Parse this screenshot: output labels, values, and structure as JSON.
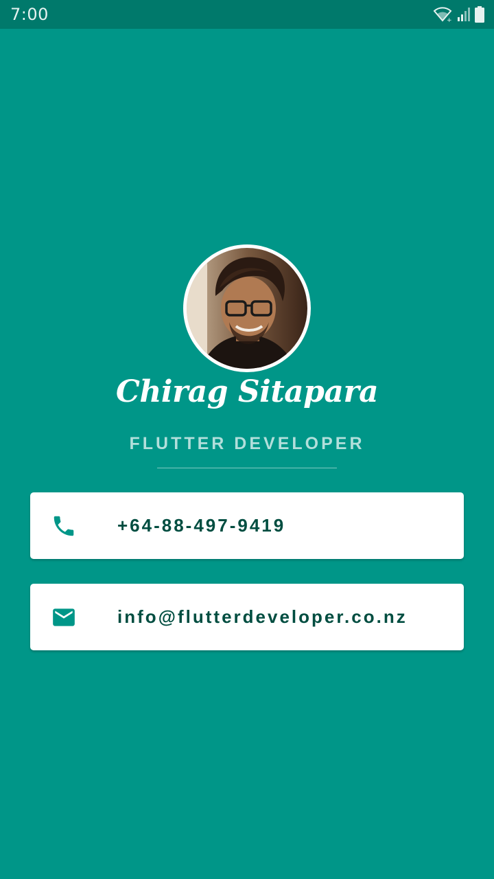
{
  "status_bar": {
    "time": "7:00",
    "icons": [
      "wifi-icon",
      "signal-icon",
      "battery-icon"
    ]
  },
  "profile": {
    "avatar": "profile-photo",
    "name": "Chirag Sitapara",
    "title": "FLUTTER DEVELOPER"
  },
  "contacts": {
    "phone": {
      "icon": "phone-icon",
      "value": "+64-88-497-9419"
    },
    "email": {
      "icon": "mail-icon",
      "value": "info@flutterdeveloper.co.nz"
    }
  },
  "colors": {
    "background": "#009688",
    "status_bar": "#00796b",
    "card": "#ffffff",
    "card_text": "#004d40",
    "icon": "#009688",
    "title_text": "#b2dfdb"
  }
}
